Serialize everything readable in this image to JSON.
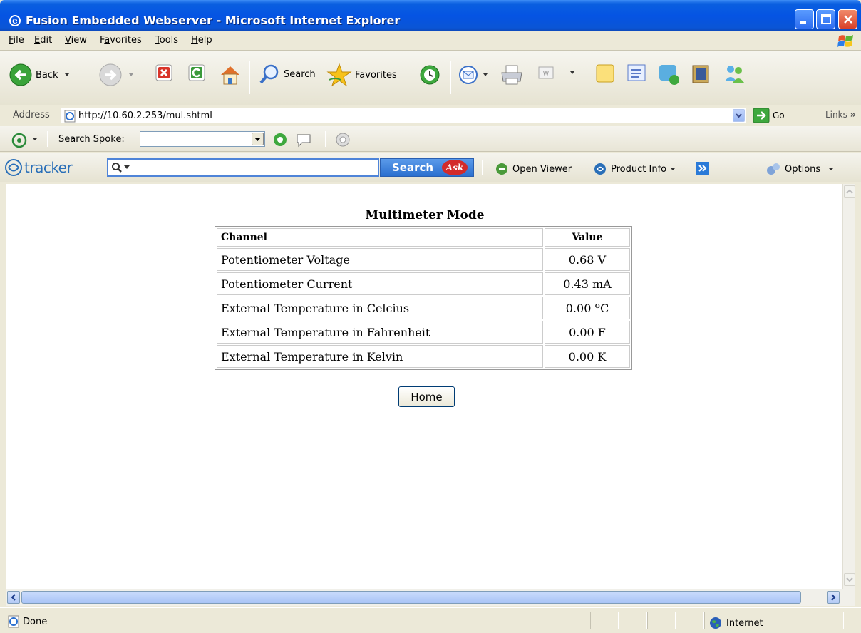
{
  "window": {
    "title": "Fusion Embedded Webserver - Microsoft Internet Explorer"
  },
  "menu": [
    {
      "pre": "",
      "ul": "F",
      "post": "ile"
    },
    {
      "pre": "",
      "ul": "E",
      "post": "dit"
    },
    {
      "pre": "",
      "ul": "V",
      "post": "iew"
    },
    {
      "pre": "F",
      "ul": "a",
      "post": "vorites"
    },
    {
      "pre": "",
      "ul": "T",
      "post": "ools"
    },
    {
      "pre": "",
      "ul": "H",
      "post": "elp"
    }
  ],
  "toolbar": {
    "back_label": "Back",
    "search_label": "Search",
    "favorites_label": "Favorites"
  },
  "address": {
    "label": "Address",
    "url": "http://10.60.2.253/mul.shtml",
    "go_label": "Go",
    "links_label": "Links"
  },
  "spoke": {
    "label": "Search Spoke:"
  },
  "tracker": {
    "logo_text": "tracker",
    "search_label": "Search",
    "ask_label": "Ask",
    "open_viewer_label": "Open Viewer",
    "product_info_label": "Product Info",
    "options_label": "Options"
  },
  "page": {
    "heading": "Multimeter Mode",
    "table": {
      "headers": [
        "Channel",
        "Value"
      ],
      "rows": [
        [
          "Potentiometer Voltage",
          "0.68 V"
        ],
        [
          "Potentiometer Current",
          "0.43 mA"
        ],
        [
          "External Temperature in Celcius",
          "0.00 ºC"
        ],
        [
          "External Temperature in Fahrenheit",
          "0.00 F"
        ],
        [
          "External Temperature in Kelvin",
          "0.00 K"
        ]
      ]
    },
    "home_label": "Home"
  },
  "status": {
    "text": "Done",
    "zone": "Internet"
  },
  "colors": {
    "titlebar": "#0554e3",
    "accent": "#2b6fcf"
  }
}
